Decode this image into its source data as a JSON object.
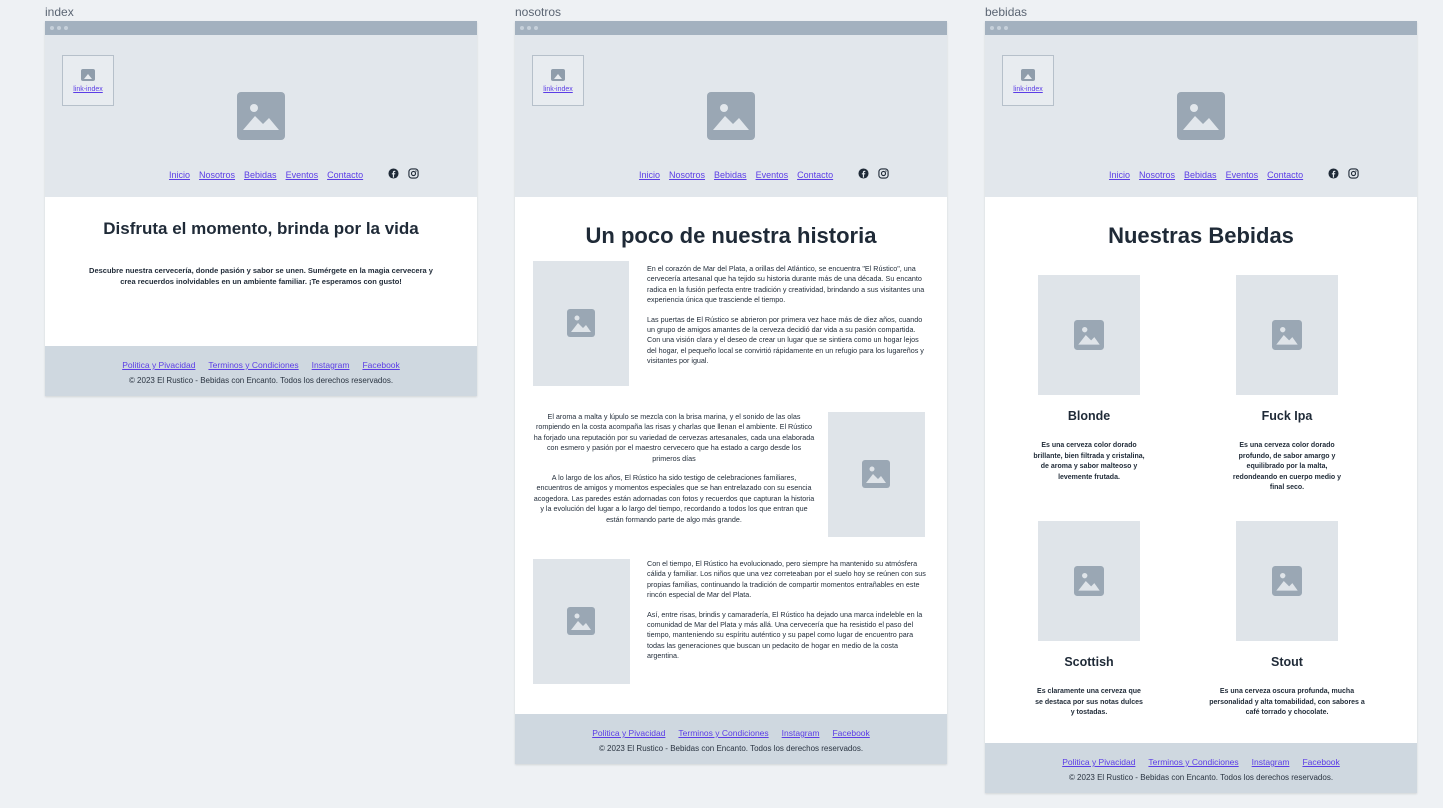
{
  "frames": {
    "index": {
      "title": "index"
    },
    "nosotros": {
      "title": "nosotros"
    },
    "bebidas": {
      "title": "bebidas"
    }
  },
  "header": {
    "logo_link": "link-index",
    "nav": [
      "Inicio",
      "Nosotros",
      "Bebidas",
      "Eventos",
      "Contacto"
    ],
    "social_icons": [
      "facebook-icon",
      "instagram-icon"
    ]
  },
  "index": {
    "heading": "Disfruta el momento, brinda por la vida",
    "tagline": "Descubre nuestra cervecería, donde pasión y sabor se unen. Sumérgete en la magia cervecera y crea recuerdos inolvidables en un ambiente familiar. ¡Te esperamos con gusto!"
  },
  "nosotros": {
    "heading": "Un poco de nuestra historia",
    "block1": [
      "En el corazón de Mar del Plata, a orillas del Atlántico, se encuentra \"El Rústico\", una cervecería artesanal que ha tejido su historia durante más de una década. Su encanto radica en la fusión perfecta entre tradición y creatividad, brindando a sus visitantes una experiencia única que trasciende el tiempo.",
      "Las puertas de El Rústico se abrieron por primera vez hace más de diez años, cuando un grupo de amigos amantes de la cerveza decidió dar vida a su pasión compartida. Con una visión clara y el deseo de crear un lugar que se sintiera como un hogar lejos del hogar, el pequeño local se convirtió rápidamente en un refugio para los lugareños y visitantes por igual."
    ],
    "block2": [
      "El aroma a malta y lúpulo se mezcla con la brisa marina, y el sonido de las olas rompiendo en la costa acompaña las risas y charlas que llenan el ambiente. El Rústico ha forjado una reputación por su variedad de cervezas artesanales, cada una elaborada con esmero y pasión por el maestro cervecero que ha estado a cargo desde los primeros días",
      "A lo largo de los años, El Rústico ha sido testigo de celebraciones familiares, encuentros de amigos y momentos especiales que se han entrelazado con su esencia acogedora. Las paredes están adornadas con fotos y recuerdos que capturan la historia y la evolución del lugar a lo largo del tiempo, recordando a todos los que entran que están formando parte de algo más grande."
    ],
    "block3": [
      "Con el tiempo, El Rústico ha evolucionado, pero siempre ha mantenido su atmósfera cálida y familiar. Los niños que una vez correteaban por el suelo hoy se reúnen con sus propias familias, continuando la tradición de compartir momentos entrañables en este rincón especial de Mar del Plata.",
      "Así, entre risas, brindis y camaradería, El Rústico ha dejado una marca indeleble en la comunidad de Mar del Plata y más allá. Una cervecería que ha resistido el paso del tiempo, manteniendo su espíritu auténtico y su papel como lugar de encuentro para todas las generaciones que buscan un pedacito de hogar en medio de la costa argentina."
    ]
  },
  "bebidas": {
    "heading": "Nuestras Bebidas",
    "items": [
      {
        "name": "Blonde",
        "desc": "Es una cerveza color dorado brillante, bien filtrada y cristalina, de aroma y sabor malteoso y levemente frutada."
      },
      {
        "name": "Fuck Ipa",
        "desc": "Es una cerveza color dorado profundo, de sabor amargo y equilibrado por la malta, redondeando en cuerpo medio y final seco."
      },
      {
        "name": "Scottish",
        "desc": "Es claramente una cerveza que se destaca por sus notas dulces y tostadas."
      },
      {
        "name": "Stout",
        "desc": "Es una cerveza oscura profunda, mucha personalidad y alta tomabilidad, con sabores a café torrado y chocolate."
      }
    ]
  },
  "footer": {
    "links": [
      "Politica y Pivacidad",
      "Terminos y Condiciones",
      "Instagram",
      "Facebook"
    ],
    "copyright": "© 2023 El Rustico - Bebidas con Encanto. Todos los derechos reservados."
  },
  "colors": {
    "link": "#5b3de6",
    "header_bg": "#e2e7ec",
    "footer_bg": "#cfd8e0",
    "placeholder": "#9aa7b4"
  }
}
